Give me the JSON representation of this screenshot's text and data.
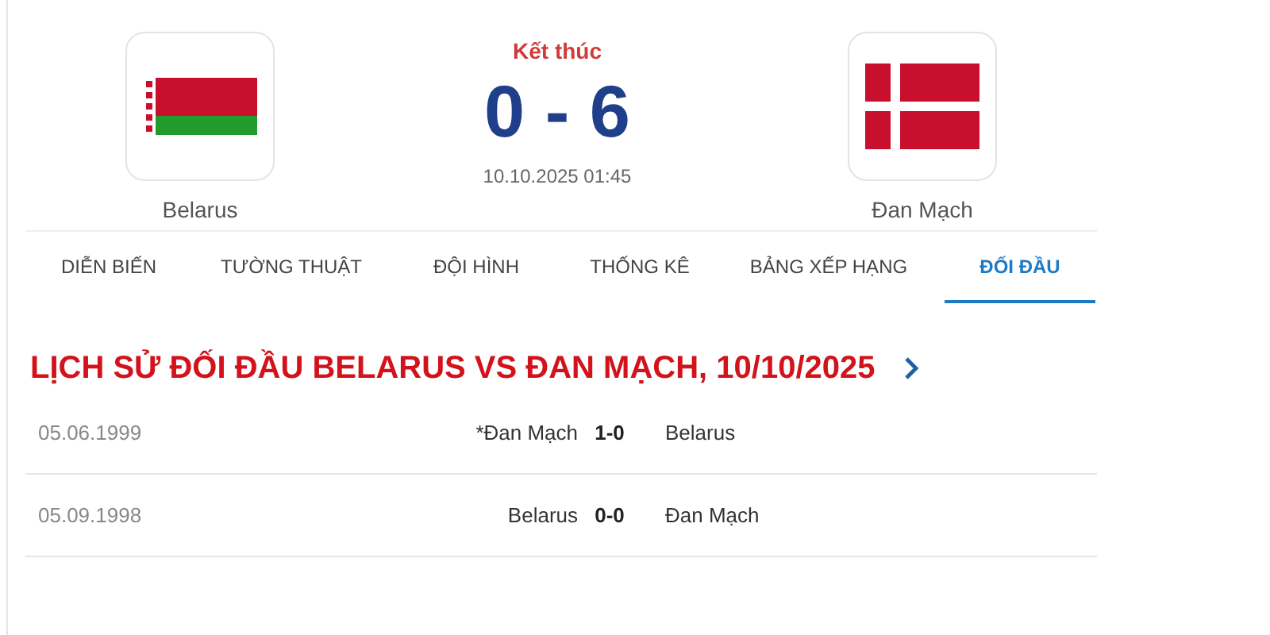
{
  "match": {
    "home": {
      "name": "Belarus",
      "kind": "belarus"
    },
    "status": "Kết thúc",
    "score": "0 - 6",
    "datetime": "10.10.2025 01:45",
    "away": {
      "name": "Đan Mạch",
      "kind": "denmark"
    }
  },
  "tabs": [
    {
      "label": "DIỄN BIẾN",
      "selected": false
    },
    {
      "label": "TƯỜNG THUẬT",
      "selected": false
    },
    {
      "label": "ĐỘI HÌNH",
      "selected": false
    },
    {
      "label": "THỐNG KÊ",
      "selected": false
    },
    {
      "label": "BẢNG XẾP HẠNG",
      "selected": false
    },
    {
      "label": "ĐỐI ĐẦU",
      "selected": true
    }
  ],
  "section_title": "LỊCH SỬ ĐỐI ĐẦU BELARUS VS ĐAN MẠCH, 10/10/2025",
  "history": [
    {
      "date": "05.06.1999",
      "home": "*Đan Mạch",
      "score": "1-0",
      "away": "Belarus"
    },
    {
      "date": "05.09.1998",
      "home": "Belarus",
      "score": "0-0",
      "away": "Đan Mạch"
    }
  ]
}
